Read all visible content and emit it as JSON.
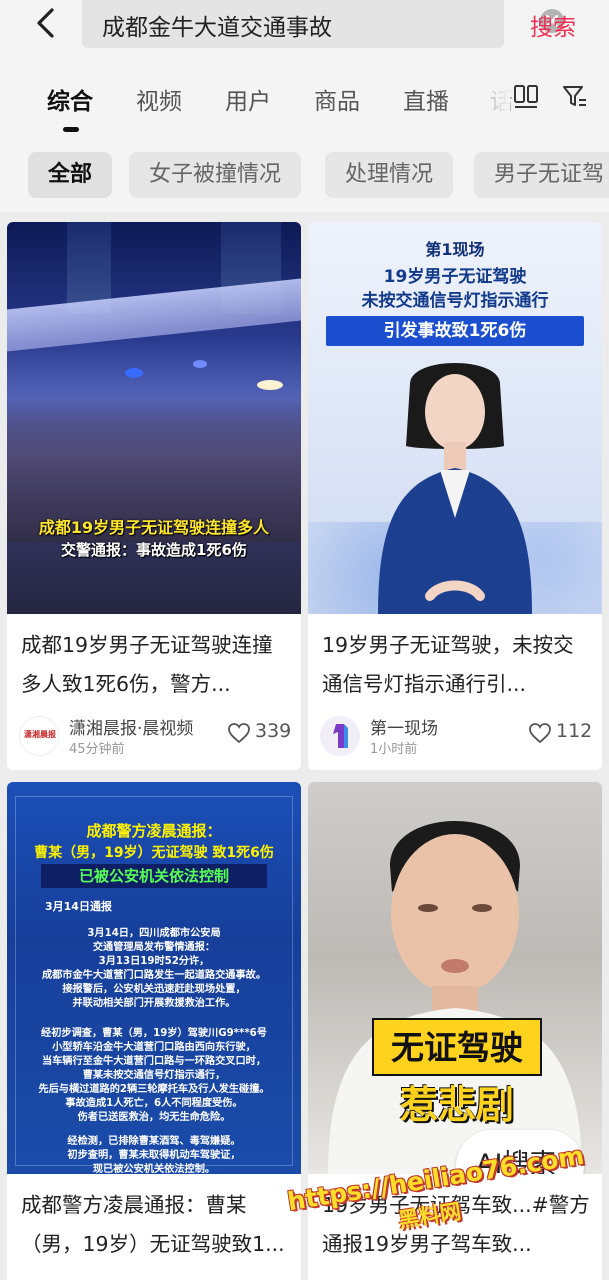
{
  "search": {
    "query": "成都金牛大道交通事故",
    "button_label": "搜索"
  },
  "tabs": [
    "综合",
    "视频",
    "用户",
    "商品",
    "直播",
    "话"
  ],
  "active_tab": "综合",
  "chips": [
    "全部",
    "女子被撞情况",
    "处理情况",
    "男子无证驾"
  ],
  "active_chip": "全部",
  "cards": [
    {
      "title": "成都19岁男子无证驾驶连撞多人致1死6伤，警方...",
      "author": "潇湘晨报·晨视频",
      "time": "45分钟前",
      "likes": "339",
      "thumb_caption_1": "成都19岁男子无证驾驶连撞多人",
      "thumb_caption_2": "交警通报：事故造成1死6伤",
      "avatar_text": "潇湘晨报"
    },
    {
      "title": "19岁男子无证驾驶，未按交通信号灯指示通行引...",
      "author": "第一现场",
      "time": "1小时前",
      "likes": "112",
      "thumb_logo": "第1现场",
      "thumb_head_1": "19岁男子无证驾驶",
      "thumb_head_2": "未按交通信号灯指示通行",
      "thumb_band": "引发事故致1死6伤"
    },
    {
      "title": "成都警方凌晨通报：曹某（男，19岁）无证驾驶致1...",
      "thumb_head_1": "成都警方凌晨通报：",
      "thumb_head_2": "曹某（男，19岁）无证驾驶 致1死6伤",
      "thumb_box": "已被公安机关依法控制",
      "thumb_date": "3月14日通报",
      "thumb_lines": [
        "3月14日，四川成都市公安局",
        "交通管理局发布警情通报：",
        "3月13日19时52分许，",
        "成都市金牛大道营门口路发生一起道路交通事故。",
        "接报警后，公安机关迅速赶赴现场处置，",
        "并联动相关部门开展救援救治工作。",
        "",
        "经初步调查，曹某（男，19岁）驾驶川G9***6号",
        "小型轿车沿金牛大道营门口路由西向东行驶，",
        "当车辆行至金牛大道营门口路与一环路交叉口时，",
        "曹某未按交通信号灯指示通行，",
        "先后与横过道路的2辆三轮摩托车及行人发生碰撞。",
        "事故造成1人死亡，6人不同程度受伤。",
        "伤者已送医救治，均无生命危险。",
        "",
        "经检测，已排除曹某酒驾、毒驾嫌疑。",
        "初步查明，曹某未取得机动车驾驶证，",
        "现已被公安机关依法控制。"
      ]
    },
    {
      "title": "19岁男子无证驾车致...#警方通报19岁男子驾车致...",
      "thumb_box": "无证驾驶",
      "thumb_sub": "惹悲剧",
      "ai_button": "AI搜索"
    }
  ],
  "watermark": {
    "url": "https://heiliao76.com",
    "name": "黑料网"
  },
  "colors": {
    "accent": "#ef2f54",
    "background": "#ececec"
  },
  "icons": [
    "back-arrow-icon",
    "clear-icon",
    "grid-icon",
    "filter-icon",
    "heart-icon"
  ]
}
